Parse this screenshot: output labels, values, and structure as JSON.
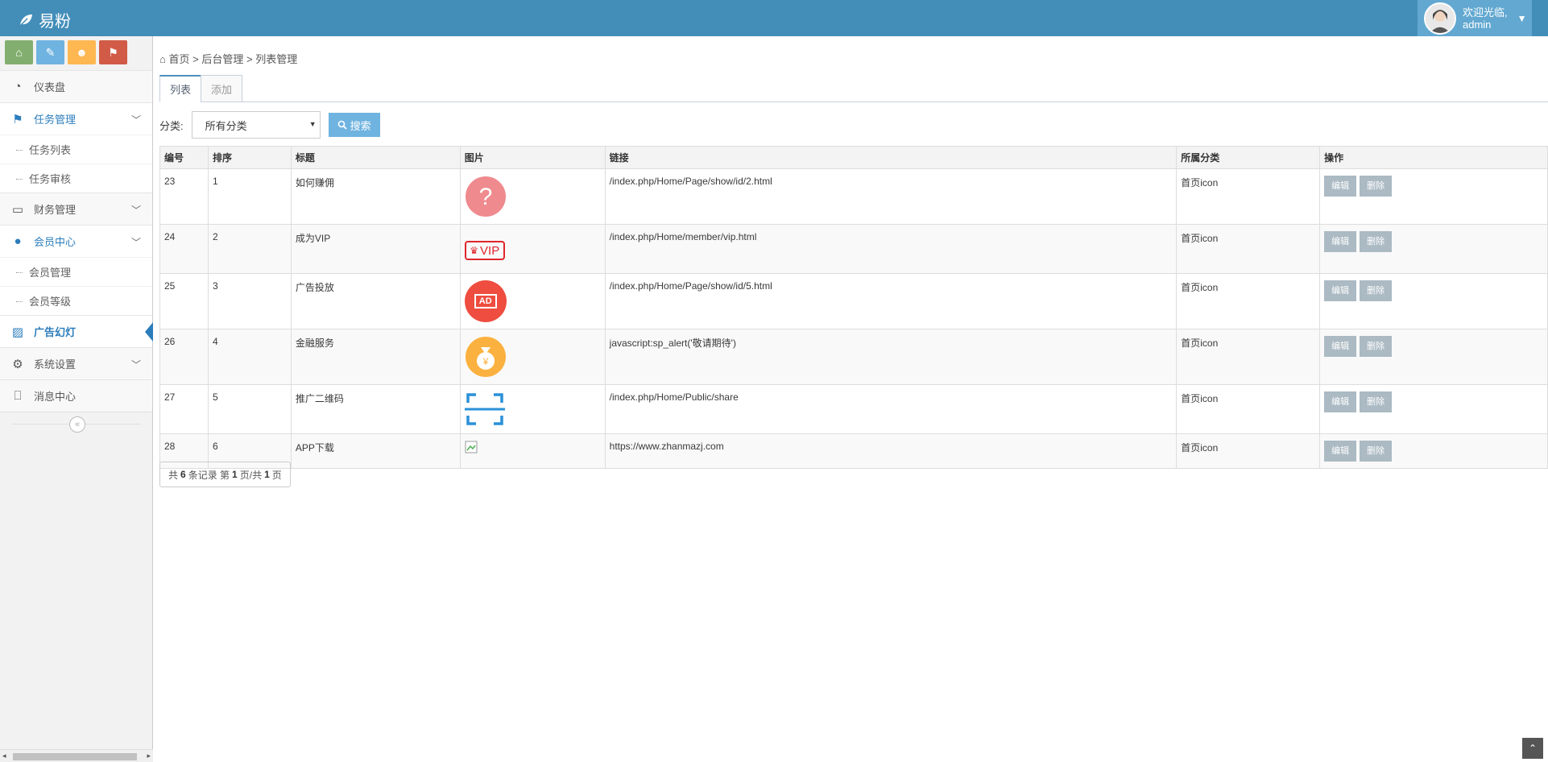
{
  "brand": {
    "name": "易粉"
  },
  "user": {
    "greeting": "欢迎光临,",
    "name": "admin"
  },
  "sidebar": {
    "shortcuts": [
      "home-icon",
      "tools-icon",
      "users-icon",
      "flag-icon"
    ],
    "items": [
      {
        "label": "仪表盘",
        "icon": "dashboard-icon"
      },
      {
        "label": "任务管理",
        "icon": "flag-icon",
        "children": [
          "任务列表",
          "任务审核"
        ]
      },
      {
        "label": "财务管理",
        "icon": "drive-icon"
      },
      {
        "label": "会员中心",
        "icon": "user-icon",
        "children": [
          "会员管理",
          "会员等级"
        ]
      },
      {
        "label": "广告幻灯",
        "icon": "picture-icon"
      },
      {
        "label": "系统设置",
        "icon": "gear-icon"
      },
      {
        "label": "消息中心",
        "icon": "bookmark-icon"
      }
    ]
  },
  "breadcrumb": {
    "home": "首页",
    "section": "后台管理",
    "current": "列表管理",
    "sep": ">"
  },
  "tabs": [
    "列表",
    "添加"
  ],
  "filter": {
    "label": "分类:",
    "selected": "所有分类",
    "search": "搜索"
  },
  "table": {
    "headers": [
      "编号",
      "排序",
      "标题",
      "图片",
      "链接",
      "所属分类",
      "操作"
    ],
    "rows": [
      {
        "id": "23",
        "order": "1",
        "title": "如何赚佣",
        "icon": "question-icon",
        "link": "/index.php/Home/Page/show/id/2.html",
        "cat": "首页icon"
      },
      {
        "id": "24",
        "order": "2",
        "title": "成为VIP",
        "icon": "vip-icon",
        "link": "/index.php/Home/member/vip.html",
        "cat": "首页icon"
      },
      {
        "id": "25",
        "order": "3",
        "title": "广告投放",
        "icon": "ad-icon",
        "link": "/index.php/Home/Page/show/id/5.html",
        "cat": "首页icon"
      },
      {
        "id": "26",
        "order": "4",
        "title": "金融服务",
        "icon": "money-bag-icon",
        "link": "javascript:sp_alert('敬请期待')",
        "cat": "首页icon"
      },
      {
        "id": "27",
        "order": "5",
        "title": "推广二维码",
        "icon": "scan-icon",
        "link": "/index.php/Home/Public/share",
        "cat": "首页icon"
      },
      {
        "id": "28",
        "order": "6",
        "title": "APP下载",
        "icon": "broken-image-icon",
        "link": "https://www.zhanmazj.com",
        "cat": "首页icon"
      }
    ],
    "edit_label": "编辑",
    "delete_label": "删除",
    "vip_text": "VIP",
    "ad_text": "AD"
  },
  "pager": {
    "prefix": "共",
    "total": "6",
    "records": "条记录 第",
    "page": "1",
    "mid": "页/共",
    "pages": "1",
    "suffix": "页"
  },
  "colors": {
    "navbar": "#438eb9",
    "accent": "#2b7dbc",
    "button": "#abbac3",
    "search": "#6fb3e0"
  }
}
